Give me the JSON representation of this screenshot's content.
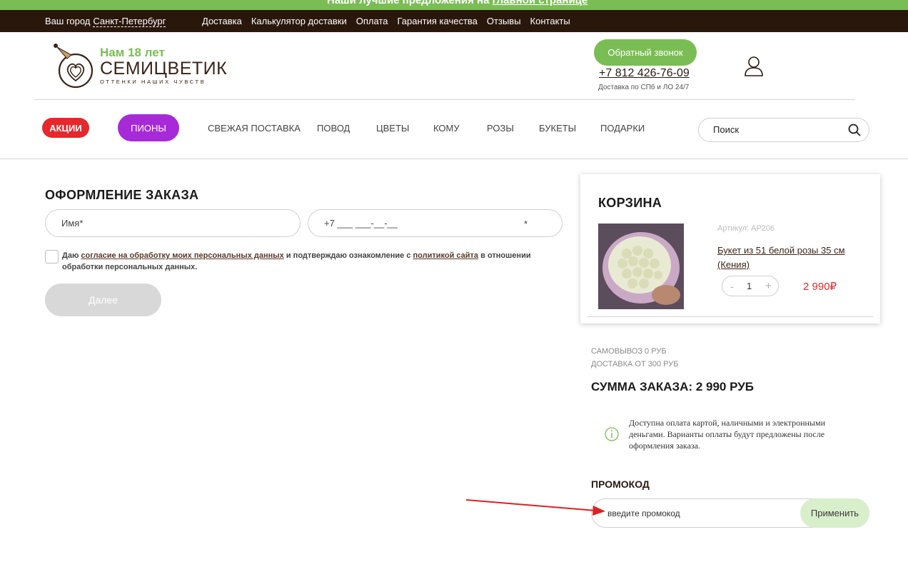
{
  "banner": {
    "text": "Наши лучшие предложения на",
    "link": "главной странице"
  },
  "topbar": {
    "city_label": "Ваш город",
    "city_value": "Санкт-Петербург",
    "links": [
      "Доставка",
      "Калькулятор доставки",
      "Оплата",
      "Гарантия качества",
      "Отзывы",
      "Контакты"
    ]
  },
  "logo": {
    "years": "Нам 18 лет",
    "brand": "СЕМИЦВЕТИК",
    "slogan": "ОТТЕНКИ НАШИХ ЧУВСТВ"
  },
  "header": {
    "callback": "Обратный звонок",
    "phone": "+7 812 426-76-09",
    "delivery_note": "Доставка по СПб и ЛО 24/7"
  },
  "nav": {
    "sale": "АКЦИИ",
    "peony": "ПИОНЫ",
    "items": [
      "СВЕЖАЯ ПОСТАВКА",
      "ПОВОД",
      "ЦВЕТЫ",
      "КОМУ",
      "РОЗЫ",
      "БУКЕТЫ",
      "ПОДАРКИ"
    ],
    "search_placeholder": "Поиск"
  },
  "order": {
    "title": "ОФОРМЛЕНИЕ ЗАКАЗА",
    "name_placeholder": "Имя*",
    "phone_placeholder": "+7 ___ ___-__-__",
    "phone_required": "*",
    "consent_prefix": "Даю",
    "consent_link1": "согласие на обработку моих персональных данных",
    "consent_mid": "и подтверждаю ознакомление с",
    "consent_link2": "политикой сайта",
    "consent_suffix": "в отношении обработки персональных данных.",
    "next_button": "Далее"
  },
  "cart": {
    "title": "КОРЗИНА",
    "item": {
      "sku": "Артикул: АР206",
      "name": "Букет из 51 белой розы 35 см (Кения)",
      "minus": "-",
      "qty": "1",
      "plus": "+",
      "price": "2 990₽"
    }
  },
  "summary": {
    "pickup": "САМОВЫВОЗ 0 РУБ",
    "delivery": "ДОСТАВКА ОТ 300 РУБ",
    "total": "СУММА ЗАКАЗА: 2 990 РУБ",
    "info": "Доступна оплата картой, наличными и электронными деньгами. Варианты оплаты будут предложены после оформления заказа."
  },
  "promo": {
    "label": "ПРОМОКОД",
    "placeholder": "введите промокод",
    "apply": "Применить"
  },
  "colors": {
    "green": "#7abd54",
    "dark": "#2a170c",
    "red": "#e6282c",
    "purple": "#a72ad8"
  }
}
